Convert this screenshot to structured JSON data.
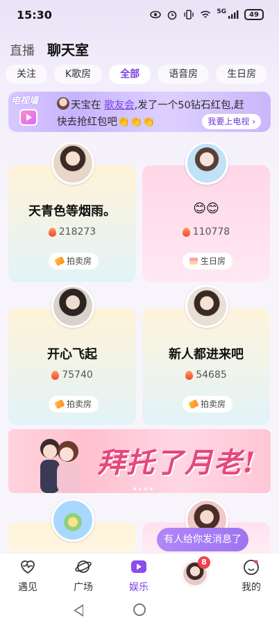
{
  "status_bar": {
    "time": "15:30",
    "network": "5G",
    "battery": "49"
  },
  "header": {
    "live": "直播",
    "chat_room": "聊天室"
  },
  "tabs": [
    {
      "label": "关注"
    },
    {
      "label": "K歌房"
    },
    {
      "label": "全部",
      "active": true
    },
    {
      "label": "语音房"
    },
    {
      "label": "生日房"
    }
  ],
  "tv_banner": {
    "tag": "电视墙",
    "line1_prefix": "天宝在 ",
    "line1_link": "歌友会",
    "line1_suffix": ",发了一个50钻石红包,赶",
    "line2": "快去抢红包吧👏👏👏",
    "button": "我要上电视 ›"
  },
  "rooms": [
    {
      "title": "天青色等烟雨。",
      "heat": "218273",
      "type": "拍卖房",
      "type_icon": "auction-icon"
    },
    {
      "title": "😊😊",
      "heat": "110778",
      "type": "生日房",
      "type_icon": "cake-icon"
    },
    {
      "title": "开心飞起",
      "heat": "75740",
      "type": "拍卖房",
      "type_icon": "auction-icon"
    },
    {
      "title": "新人都进来吧",
      "heat": "54685",
      "type": "拍卖房",
      "type_icon": "auction-icon"
    }
  ],
  "promo": {
    "text": "拜托了月老!"
  },
  "toast": {
    "text": "有人给你发消息了"
  },
  "bottom_nav": {
    "items": [
      {
        "label": "遇见",
        "icon": "heartbeat-icon"
      },
      {
        "label": "广场",
        "icon": "planet-icon"
      },
      {
        "label": "娱乐",
        "icon": "play-icon",
        "active": true
      },
      {
        "label": "",
        "icon": "avatar"
      },
      {
        "label": "我的",
        "icon": "smile-icon"
      }
    ],
    "badge": "8"
  },
  "colors": {
    "accent": "#7b3fe4",
    "badge": "#f2414f",
    "promo_text": "#e5477e"
  }
}
